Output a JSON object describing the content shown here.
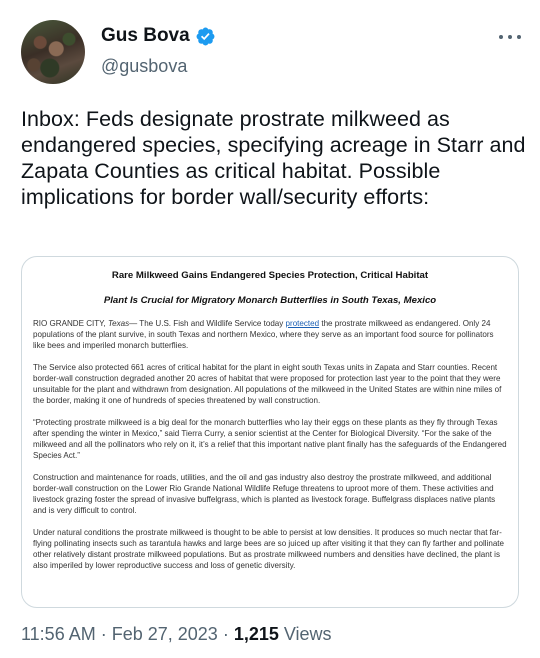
{
  "author": {
    "display_name": "Gus Bova",
    "handle": "@gusbova"
  },
  "tweet_text": "Inbox: Feds designate prostrate milkweed as endangered species, specifying acreage in Starr and Zapata Counties as critical habitat. Possible implications for border wall/security efforts:",
  "press_release": {
    "title": "Rare Milkweed Gains Endangered Species Protection, Critical Habitat",
    "subtitle": "Plant Is Crucial for Migratory Monarch Butterflies in South Texas, Mexico",
    "p1_dateline": "RIO GRANDE CITY, ",
    "p1_dateline_italic": "Texas",
    "p1_before_link": "— The U.S. Fish and Wildlife Service today ",
    "p1_link": "protected",
    "p1_after_link": " the prostrate milkweed as endangered. Only 24 populations of the plant survive, in south Texas and northern Mexico, where they serve as an important food source for pollinators like bees and imperiled monarch butterflies.",
    "p2": "The Service also protected 661 acres of critical habitat for the plant in eight south Texas units in Zapata and Starr counties. Recent border-wall construction degraded another 20 acres of habitat that were proposed for protection last year to the point that they were unsuitable for the plant and withdrawn from designation. All populations of the milkweed in the United States are within nine miles of the border, making it one of hundreds of species threatened by wall construction.",
    "p3": "“Protecting prostrate milkweed is a big deal for the monarch butterflies who lay their eggs on these plants as they fly through Texas after spending the winter in Mexico,” said Tierra Curry, a senior scientist at the Center for Biological Diversity. “For the sake of the milkweed and all the pollinators who rely on it, it’s a relief that this important native plant finally has the safeguards of the Endangered Species Act.”",
    "p4": "Construction and maintenance for roads, utilities, and the oil and gas industry also destroy the prostrate milkweed, and additional border-wall construction on the Lower Rio Grande National Wildlife Refuge threatens to uproot more of them. These activities and livestock grazing foster the spread of invasive buffelgrass, which is planted as livestock forage. Buffelgrass displaces native plants and is very difficult to control.",
    "p5": "Under natural conditions the prostrate milkweed is thought to be able to persist at low densities. It produces so much nectar that far-flying pollinating insects such as tarantula hawks and large bees are so juiced up after visiting it that they can fly farther and pollinate other relatively distant prostrate milkweed populations. But as prostrate milkweed numbers and densities have declined, the plant is also imperiled by lower reproductive success and loss of genetic diversity."
  },
  "footer": {
    "time": "11:56 AM",
    "separator": " · ",
    "date": "Feb 27, 2023",
    "views_count": "1,215",
    "views_label": " Views"
  },
  "icons": {
    "verified": "verified-badge-icon",
    "more": "more-horizontal-icon"
  },
  "colors": {
    "verified_blue": "#1d9bf0",
    "secondary_text": "#536471",
    "link": "#1a5fb4"
  }
}
